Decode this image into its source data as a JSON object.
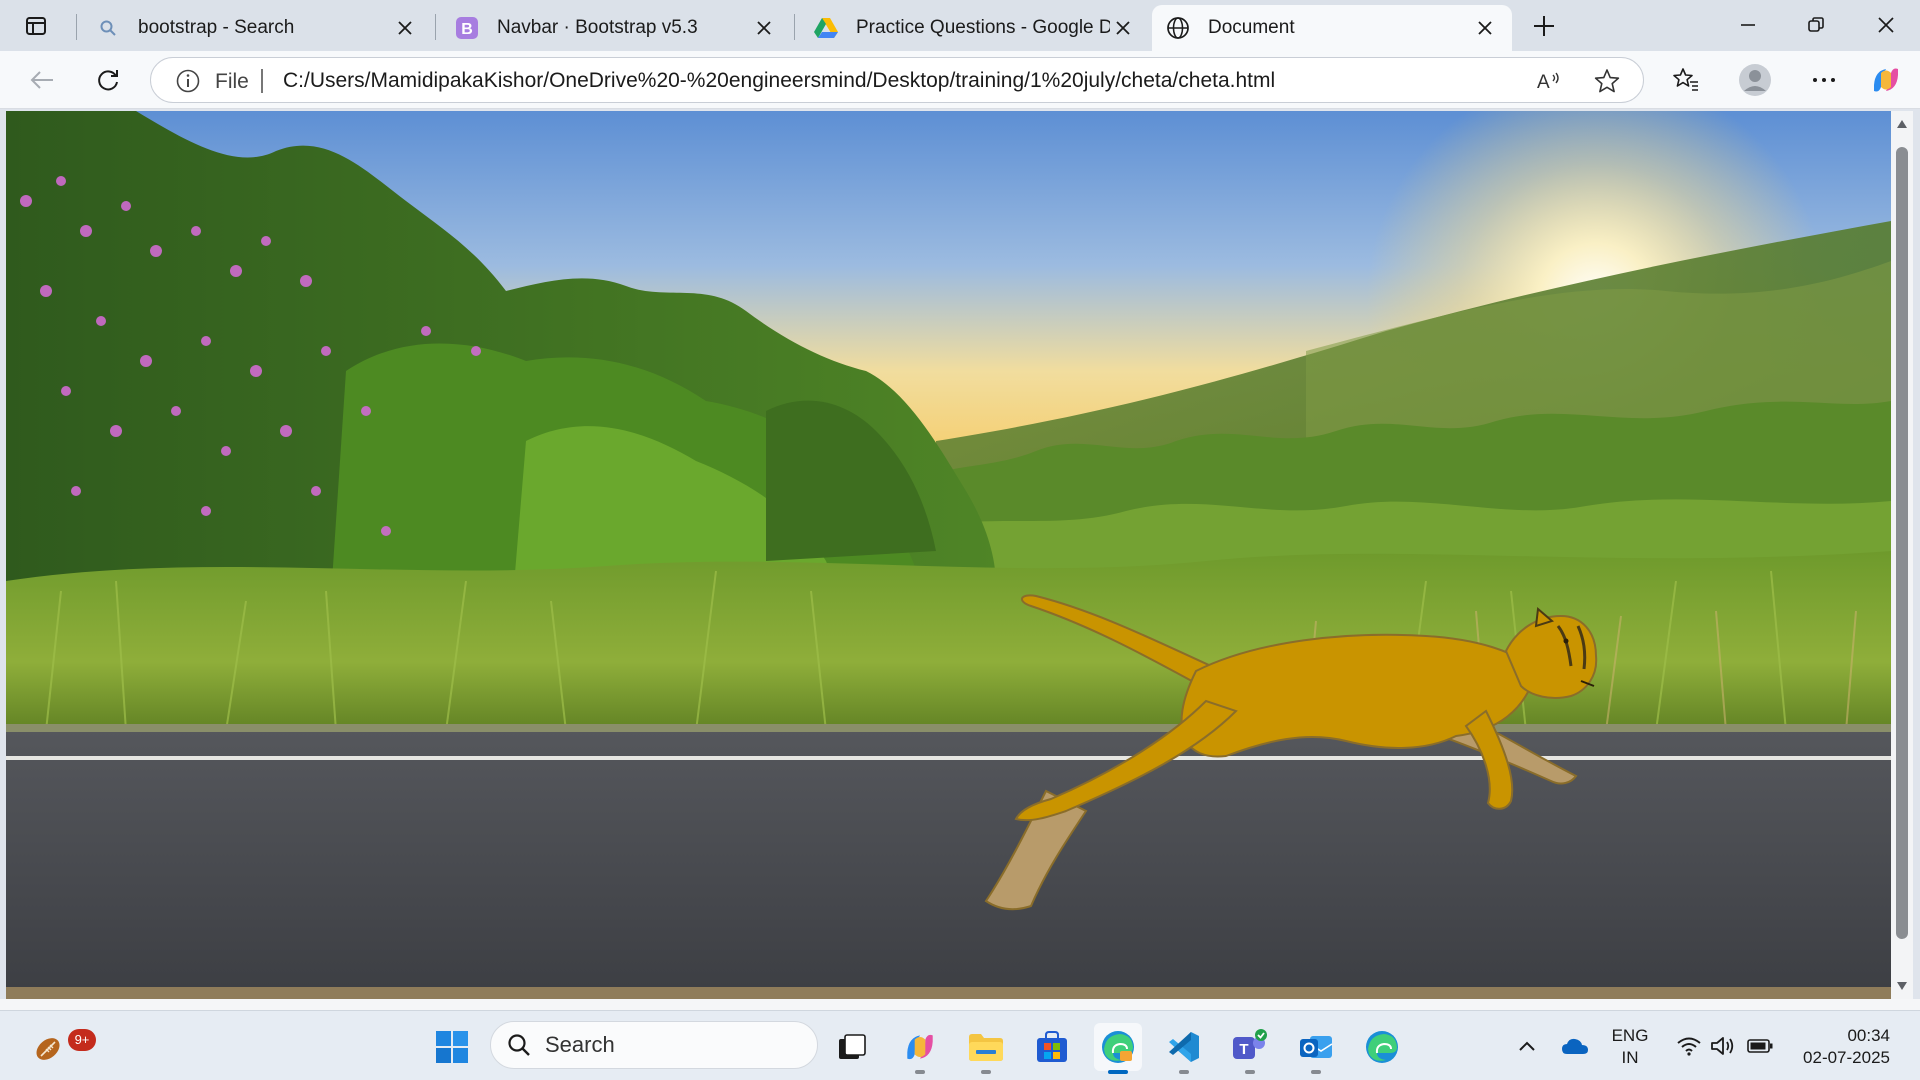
{
  "browser": {
    "tabs": [
      {
        "title": "bootstrap - Search",
        "icon": "search-icon",
        "active": false
      },
      {
        "title": "Navbar · Bootstrap v5.3",
        "icon": "bootstrap-logo-icon",
        "active": false
      },
      {
        "title": "Practice Questions - Google Drive",
        "icon": "google-drive-icon",
        "active": false
      },
      {
        "title": "Document",
        "icon": "globe-icon",
        "active": true
      }
    ],
    "address": {
      "scheme": "File",
      "url": "C:/Users/MamidipakaKishor/OneDrive%20-%20engineersmind/Desktop/training/1%20july/cheta/cheta.html"
    }
  },
  "page": {
    "scene_description_name": "cheetah-running-on-road-scene",
    "colors": {
      "cat": "#c99400",
      "cat_outline": "#8a6d2a",
      "road": "#46484d",
      "sky_top": "#5d8fd4",
      "sun": "#fff3c4"
    }
  },
  "taskbar": {
    "search_label": "Search",
    "notification_badge": "9+",
    "language": [
      "ENG",
      "IN"
    ],
    "time": "00:34",
    "date": "02-07-2025"
  }
}
